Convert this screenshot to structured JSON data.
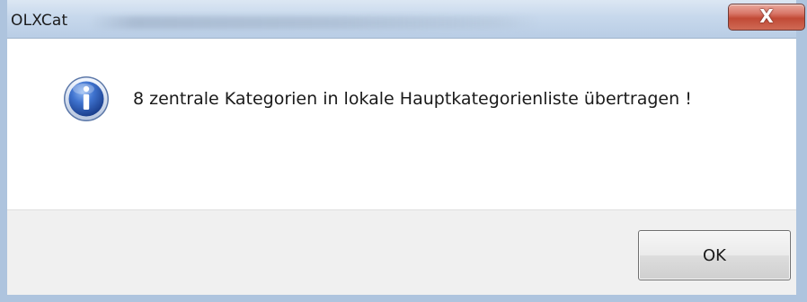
{
  "window": {
    "title": "OLXCat",
    "close_glyph": "X"
  },
  "dialog": {
    "icon": "information-icon",
    "message": "8 zentrale Kategorien in lokale Hauptkategorienliste übertragen !",
    "ok_label": "OK"
  },
  "colors": {
    "frame": "#b3c8e0",
    "close_button": "#c24a36",
    "info_icon": "#2c5fb8",
    "footer": "#f0f0f0"
  }
}
